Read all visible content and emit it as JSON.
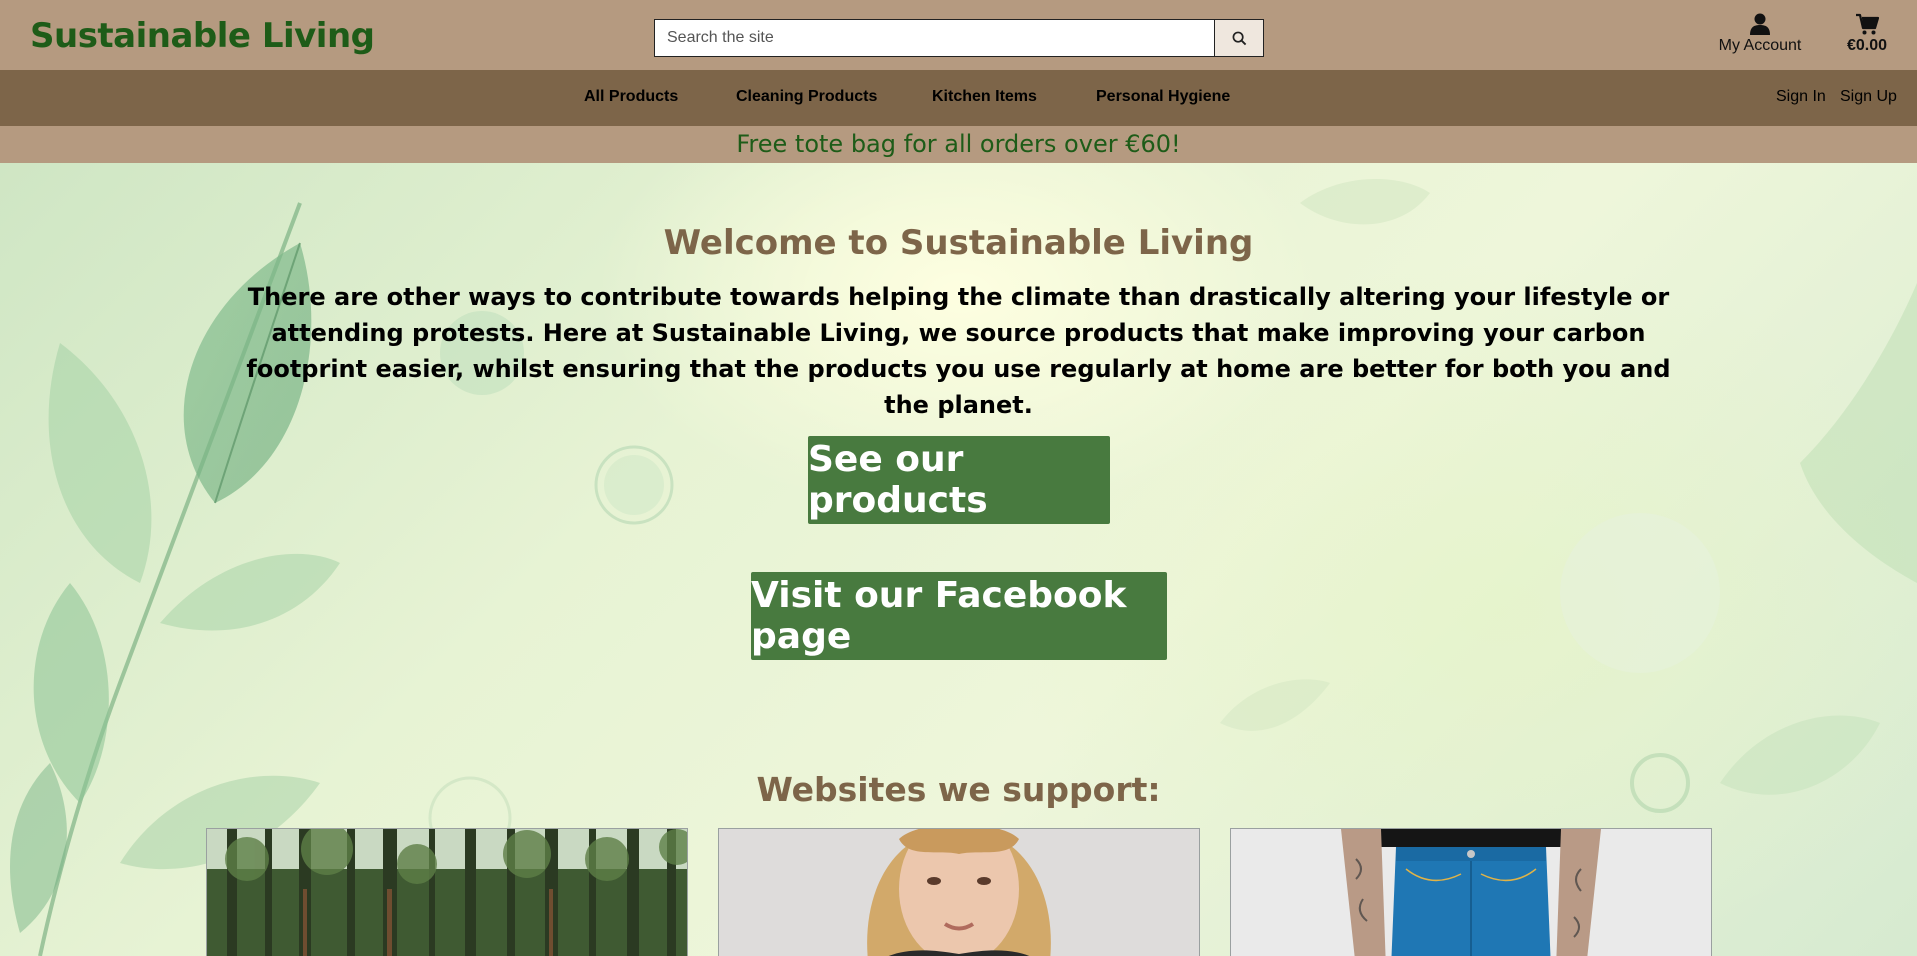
{
  "header": {
    "logo": "Sustainable Living",
    "search_placeholder": "Search the site",
    "account_label": "My Account",
    "cart_total": "€0.00"
  },
  "nav": {
    "items": [
      "All Products",
      "Cleaning Products",
      "Kitchen Items",
      "Personal Hygiene"
    ],
    "sign_in": "Sign In",
    "sign_up": "Sign Up"
  },
  "promo": "Free tote bag for all orders over €60!",
  "hero": {
    "title": "Welcome to Sustainable Living",
    "intro": "There are other ways to contribute towards helping the climate than drastically altering your lifestyle or attending protests. Here at Sustainable Living, we source products that make improving your carbon footprint easier, whilst ensuring that the products you use regularly at home are better for both you and the planet.",
    "products_button": "See our products",
    "facebook_button": "Visit our Facebook page"
  },
  "support": {
    "title": "Websites we support:",
    "cards": [
      {
        "image": "forest-image"
      },
      {
        "image": "woman-portrait-image"
      },
      {
        "image": "blue-jeans-image"
      }
    ]
  },
  "colors": {
    "header_bg": "#b59a80",
    "nav_bg": "#7d6549",
    "brand_green": "#1e5c18",
    "button_green": "#487a3f",
    "heading_brown": "#7d6549"
  }
}
